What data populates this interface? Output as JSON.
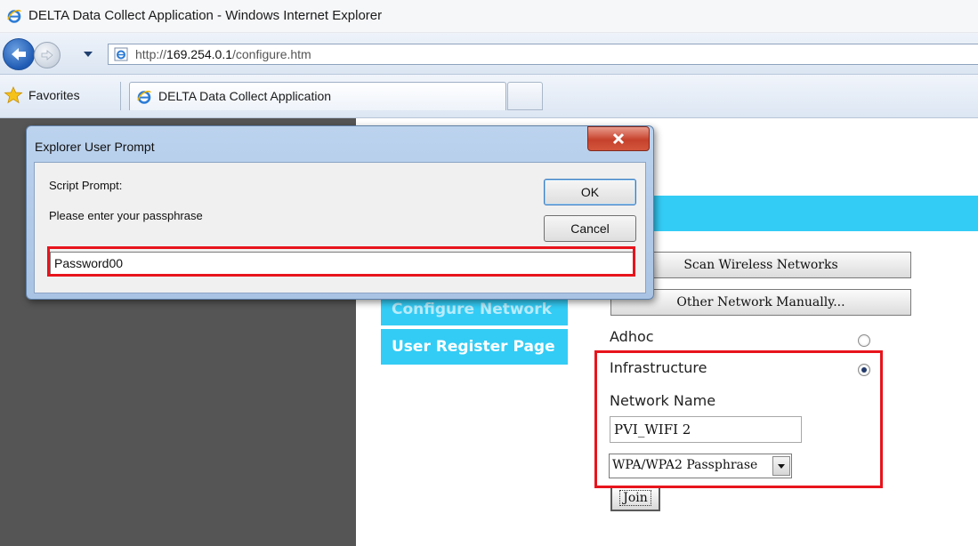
{
  "window": {
    "title": "DELTA Data Collect Application - Windows Internet Explorer",
    "icon": "ie-logo-icon"
  },
  "address_bar": {
    "url_prefix": "http://",
    "url_host": "169.254.0.1",
    "url_path": "/configure.htm"
  },
  "favorites_bar": {
    "favorites_label": "Favorites",
    "active_tab_label": "DELTA Data Collect Application"
  },
  "dialog": {
    "title": "Explorer User Prompt",
    "script_prompt_label": "Script Prompt:",
    "message": "Please enter your passphrase",
    "input_value": "Password00",
    "ok_label": "OK",
    "cancel_label": "Cancel"
  },
  "page": {
    "side_menu": {
      "configure_network": "Configure Network",
      "user_register": "User Register Page"
    },
    "scan_button_label": "Scan Wireless Networks",
    "other_network_button_label": "Other Network Manually...",
    "adhoc_label": "Adhoc",
    "infrastructure_label": "Infrastructure",
    "network_name_label": "Network Name",
    "network_name_value": "PVI_WIFI 2",
    "security_selected": "WPA/WPA2 Passphrase",
    "join_label": "Join",
    "mode_selected": "Infrastructure"
  },
  "colors": {
    "cyan_accent": "#33ccf5",
    "highlight_red": "#e8141c",
    "dark_panel": "#555555"
  }
}
